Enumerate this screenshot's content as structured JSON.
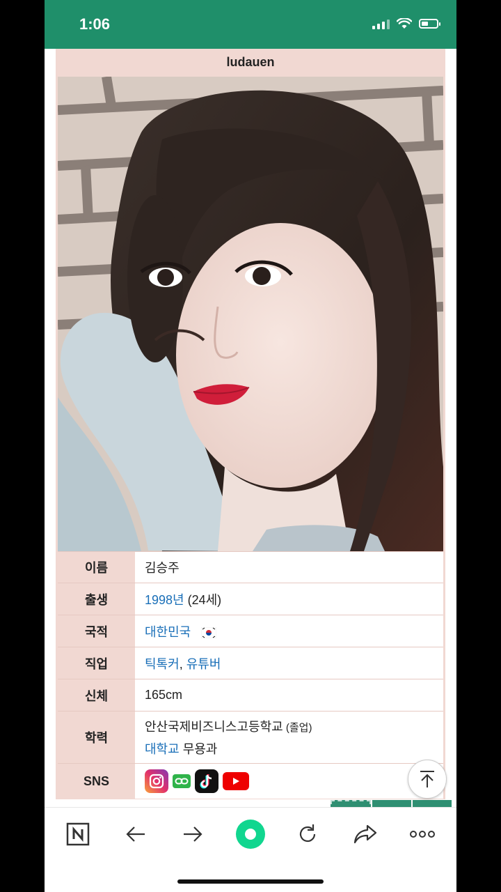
{
  "status": {
    "time": "1:06"
  },
  "card": {
    "title": "ludauen"
  },
  "info": {
    "name_label": "이름",
    "name_value": "김승주",
    "birth_label": "출생",
    "birth_year": "1998년",
    "birth_age": " (24세)",
    "nation_label": "국적",
    "nation_value": "대한민국",
    "job_label": "직업",
    "job_tiktoker": "틱톡커",
    "job_sep": ", ",
    "job_youtuber": "유튜버",
    "body_label": "신체",
    "body_value": "165cm",
    "edu_label": "학력",
    "edu_school": "안산국제비즈니스고등학교",
    "edu_status": " (졸업)",
    "edu_univ": "대학교",
    "edu_major": " 무용과",
    "sns_label": "SNS"
  },
  "icons": {
    "sns": [
      "instagram-icon",
      "link-icon",
      "tiktok-icon",
      "youtube-icon"
    ],
    "toolbar": [
      "naver-n-icon",
      "back-arrow-icon",
      "forward-arrow-icon",
      "green-dot-icon",
      "refresh-icon",
      "share-icon",
      "more-icon"
    ]
  },
  "colors": {
    "status_bar": "#1f8f6a",
    "accent_green": "#2f8f72",
    "label_bg": "#f1d8d2",
    "link": "#1a6fb8"
  }
}
